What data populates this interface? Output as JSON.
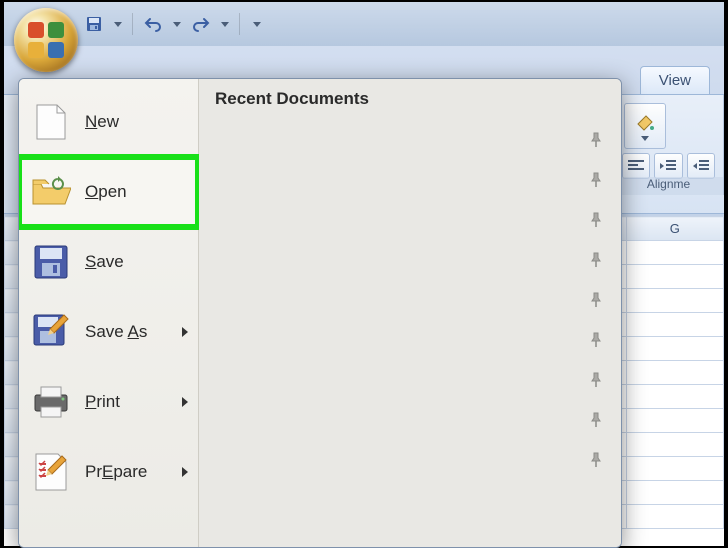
{
  "qat": {
    "save_tip": "Save",
    "undo_tip": "Undo",
    "redo_tip": "Redo"
  },
  "ribbon": {
    "visible_tab": "View",
    "group_label": "Alignme"
  },
  "sheet": {
    "visible_col_header": "G"
  },
  "office_menu": {
    "recent_header": "Recent Documents",
    "items": [
      {
        "label": "New",
        "accel": "N",
        "has_submenu": false
      },
      {
        "label": "Open",
        "accel": "O",
        "has_submenu": false,
        "highlighted": true
      },
      {
        "label": "Save",
        "accel": "S",
        "has_submenu": false
      },
      {
        "label": "Save As",
        "accel": "A",
        "has_submenu": true
      },
      {
        "label": "Print",
        "accel": "P",
        "has_submenu": true
      },
      {
        "label": "Prepare",
        "accel": "E",
        "has_submenu": true
      }
    ],
    "pin_count": 9
  }
}
